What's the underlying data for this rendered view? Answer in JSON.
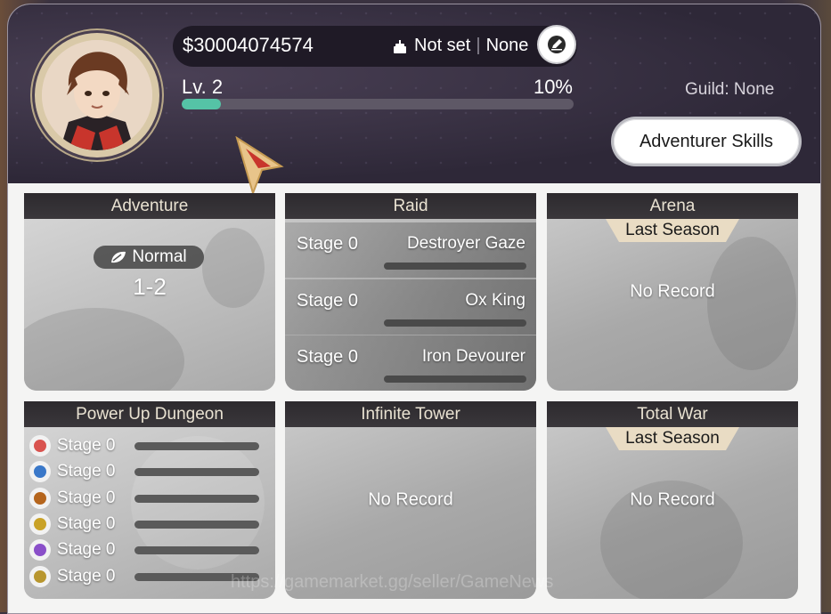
{
  "profile": {
    "money": "$30004074574",
    "birthday": "Not set",
    "separator": "|",
    "birthday_extra": "None",
    "level": "Lv. 2",
    "xp_percent_label": "10%",
    "xp_percent": 10,
    "guild": "Guild: None",
    "adventurer_skills": "Adventurer Skills"
  },
  "cards": {
    "adventure": {
      "title": "Adventure",
      "mode": "Normal",
      "stage": "1-2"
    },
    "raid": {
      "title": "Raid",
      "rows": [
        {
          "stage": "Stage 0",
          "boss": "Destroyer Gaze"
        },
        {
          "stage": "Stage 0",
          "boss": "Ox King"
        },
        {
          "stage": "Stage 0",
          "boss": "Iron Devourer"
        }
      ]
    },
    "arena": {
      "title": "Arena",
      "badge": "Last Season",
      "status": "No Record"
    },
    "power_up_dungeon": {
      "title": "Power Up Dungeon",
      "rows": [
        {
          "stage": "Stage 0",
          "icon": "fire-element-icon",
          "color": "#d9534f"
        },
        {
          "stage": "Stage 0",
          "icon": "water-element-icon",
          "color": "#3a78c9"
        },
        {
          "stage": "Stage 0",
          "icon": "earth-element-icon",
          "color": "#b5651d"
        },
        {
          "stage": "Stage 0",
          "icon": "light-element-icon",
          "color": "#c9a227"
        },
        {
          "stage": "Stage 0",
          "icon": "dark-element-icon",
          "color": "#8a4fc9"
        },
        {
          "stage": "Stage 0",
          "icon": "gold-element-icon",
          "color": "#b8962e"
        }
      ]
    },
    "infinite_tower": {
      "title": "Infinite Tower",
      "status": "No Record"
    },
    "total_war": {
      "title": "Total War",
      "badge": "Last Season",
      "status": "No Record"
    }
  },
  "watermark": "https://gamemarket.gg/seller/GameNews",
  "colors": {
    "xp_fill": "#55c3a6",
    "header_bg": "#2e2838",
    "card_title_bg": "#2d2a2e"
  }
}
